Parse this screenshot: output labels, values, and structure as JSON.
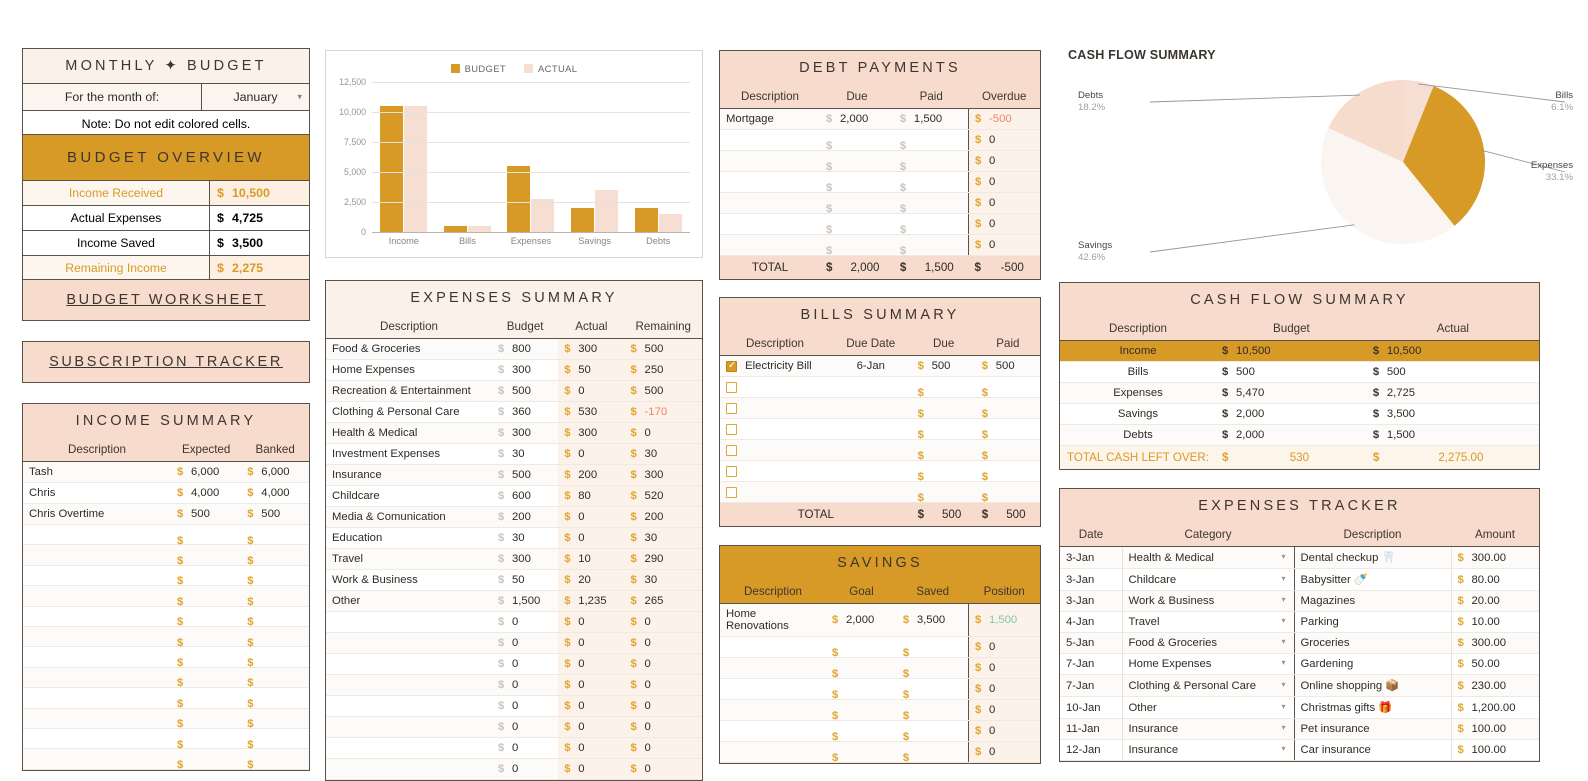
{
  "monthly_budget": {
    "title": "MONTHLY ✦ BUDGET",
    "month_label": "For the month of:",
    "month_value": "January",
    "note": "Note: Do not edit colored cells."
  },
  "budget_overview": {
    "title": "BUDGET OVERVIEW",
    "rows": [
      {
        "label": "Income Received",
        "amount": "10,500",
        "highlight": true
      },
      {
        "label": "Actual Expenses",
        "amount": "4,725",
        "highlight": false
      },
      {
        "label": "Income Saved",
        "amount": "3,500",
        "highlight": false
      },
      {
        "label": "Remaining Income",
        "amount": "2,275",
        "highlight": true
      }
    ]
  },
  "nav": {
    "budget_worksheet": "BUDGET WORKSHEET",
    "subscription_tracker": "SUBSCRIPTION TRACKER"
  },
  "income_summary": {
    "title": "INCOME SUMMARY",
    "columns": [
      "Description",
      "Expected",
      "Banked"
    ],
    "rows": [
      {
        "description": "Tash",
        "expected": "6,000",
        "banked": "6,000"
      },
      {
        "description": "Chris",
        "expected": "4,000",
        "banked": "4,000"
      },
      {
        "description": "Chris Overtime",
        "expected": "500",
        "banked": "500"
      },
      {
        "description": "",
        "expected": "",
        "banked": ""
      },
      {
        "description": "",
        "expected": "",
        "banked": ""
      },
      {
        "description": "",
        "expected": "",
        "banked": ""
      },
      {
        "description": "",
        "expected": "",
        "banked": ""
      },
      {
        "description": "",
        "expected": "",
        "banked": ""
      },
      {
        "description": "",
        "expected": "",
        "banked": ""
      },
      {
        "description": "",
        "expected": "",
        "banked": ""
      },
      {
        "description": "",
        "expected": "",
        "banked": ""
      },
      {
        "description": "",
        "expected": "",
        "banked": ""
      },
      {
        "description": "",
        "expected": "",
        "banked": ""
      },
      {
        "description": "",
        "expected": "",
        "banked": ""
      },
      {
        "description": "",
        "expected": "",
        "banked": ""
      }
    ]
  },
  "expenses_summary": {
    "title": "EXPENSES SUMMARY",
    "columns": [
      "Description",
      "Budget",
      "Actual",
      "Remaining"
    ],
    "rows": [
      {
        "description": "Food & Groceries",
        "budget": "800",
        "actual": "300",
        "remaining": "500"
      },
      {
        "description": "Home Expenses",
        "budget": "300",
        "actual": "50",
        "remaining": "250"
      },
      {
        "description": "Recreation & Entertainment",
        "budget": "500",
        "actual": "0",
        "remaining": "500"
      },
      {
        "description": "Clothing & Personal Care",
        "budget": "360",
        "actual": "530",
        "remaining": "-170",
        "negative": true
      },
      {
        "description": "Health & Medical",
        "budget": "300",
        "actual": "300",
        "remaining": "0"
      },
      {
        "description": "Investment Expenses",
        "budget": "30",
        "actual": "0",
        "remaining": "30"
      },
      {
        "description": "Insurance",
        "budget": "500",
        "actual": "200",
        "remaining": "300"
      },
      {
        "description": "Childcare",
        "budget": "600",
        "actual": "80",
        "remaining": "520"
      },
      {
        "description": "Media & Comunication",
        "budget": "200",
        "actual": "0",
        "remaining": "200"
      },
      {
        "description": "Education",
        "budget": "30",
        "actual": "0",
        "remaining": "30"
      },
      {
        "description": "Travel",
        "budget": "300",
        "actual": "10",
        "remaining": "290"
      },
      {
        "description": "Work & Business",
        "budget": "50",
        "actual": "20",
        "remaining": "30"
      },
      {
        "description": "Other",
        "budget": "1,500",
        "actual": "1,235",
        "remaining": "265"
      },
      {
        "description": "",
        "budget": "0",
        "actual": "0",
        "remaining": "0"
      },
      {
        "description": "",
        "budget": "0",
        "actual": "0",
        "remaining": "0"
      },
      {
        "description": "",
        "budget": "0",
        "actual": "0",
        "remaining": "0"
      },
      {
        "description": "",
        "budget": "0",
        "actual": "0",
        "remaining": "0"
      },
      {
        "description": "",
        "budget": "0",
        "actual": "0",
        "remaining": "0"
      },
      {
        "description": "",
        "budget": "0",
        "actual": "0",
        "remaining": "0"
      },
      {
        "description": "",
        "budget": "0",
        "actual": "0",
        "remaining": "0"
      },
      {
        "description": "",
        "budget": "0",
        "actual": "0",
        "remaining": "0"
      }
    ]
  },
  "debt_payments": {
    "title": "DEBT PAYMENTS",
    "columns": [
      "Description",
      "Due",
      "Paid",
      "Overdue"
    ],
    "rows": [
      {
        "description": "Mortgage",
        "due": "2,000",
        "paid": "1,500",
        "overdue": "-500",
        "negative": true
      },
      {
        "description": "",
        "due": "",
        "paid": "",
        "overdue": "0"
      },
      {
        "description": "",
        "due": "",
        "paid": "",
        "overdue": "0"
      },
      {
        "description": "",
        "due": "",
        "paid": "",
        "overdue": "0"
      },
      {
        "description": "",
        "due": "",
        "paid": "",
        "overdue": "0"
      },
      {
        "description": "",
        "due": "",
        "paid": "",
        "overdue": "0"
      },
      {
        "description": "",
        "due": "",
        "paid": "",
        "overdue": "0"
      }
    ],
    "total_label": "TOTAL",
    "total_due": "2,000",
    "total_paid": "1,500",
    "total_overdue": "-500"
  },
  "bills_summary": {
    "title": "BILLS SUMMARY",
    "columns": [
      "Description",
      "Due Date",
      "Due",
      "Paid"
    ],
    "rows": [
      {
        "checked": true,
        "description": "Electricity Bill",
        "due_date": "6-Jan",
        "due": "500",
        "paid": "500"
      },
      {
        "checked": false,
        "description": "",
        "due_date": "",
        "due": "",
        "paid": ""
      },
      {
        "checked": false,
        "description": "",
        "due_date": "",
        "due": "",
        "paid": ""
      },
      {
        "checked": false,
        "description": "",
        "due_date": "",
        "due": "",
        "paid": ""
      },
      {
        "checked": false,
        "description": "",
        "due_date": "",
        "due": "",
        "paid": ""
      },
      {
        "checked": false,
        "description": "",
        "due_date": "",
        "due": "",
        "paid": ""
      },
      {
        "checked": false,
        "description": "",
        "due_date": "",
        "due": "",
        "paid": ""
      }
    ],
    "total_label": "TOTAL",
    "total_due": "500",
    "total_paid": "500"
  },
  "savings": {
    "title": "SAVINGS",
    "columns": [
      "Description",
      "Goal",
      "Saved",
      "Position"
    ],
    "rows": [
      {
        "description": "Home Renovations",
        "goal": "2,000",
        "saved": "3,500",
        "position": "1,500",
        "positive": true
      },
      {
        "description": "",
        "goal": "",
        "saved": "",
        "position": "0"
      },
      {
        "description": "",
        "goal": "",
        "saved": "",
        "position": "0"
      },
      {
        "description": "",
        "goal": "",
        "saved": "",
        "position": "0"
      },
      {
        "description": "",
        "goal": "",
        "saved": "",
        "position": "0"
      },
      {
        "description": "",
        "goal": "",
        "saved": "",
        "position": "0"
      },
      {
        "description": "",
        "goal": "",
        "saved": "",
        "position": "0"
      }
    ]
  },
  "cash_flow_table": {
    "title": "CASH FLOW SUMMARY",
    "columns": [
      "Description",
      "Budget",
      "Actual"
    ],
    "rows": [
      {
        "description": "Income",
        "budget": "10,500",
        "actual": "10,500",
        "gold": true
      },
      {
        "description": "Bills",
        "budget": "500",
        "actual": "500",
        "gold": false
      },
      {
        "description": "Expenses",
        "budget": "5,470",
        "actual": "2,725",
        "gold": false
      },
      {
        "description": "Savings",
        "budget": "2,000",
        "actual": "3,500",
        "gold": false
      },
      {
        "description": "Debts",
        "budget": "2,000",
        "actual": "1,500",
        "gold": false
      }
    ],
    "total_label": "TOTAL CASH LEFT OVER:",
    "total_budget": "530",
    "total_actual": "2,275.00"
  },
  "expenses_tracker": {
    "title": "EXPENSES TRACKER",
    "columns": [
      "Date",
      "Category",
      "Description",
      "Amount"
    ],
    "rows": [
      {
        "date": "3-Jan",
        "category": "Health & Medical",
        "description": "Dental checkup 🦷",
        "amount": "300.00"
      },
      {
        "date": "3-Jan",
        "category": "Childcare",
        "description": "Babysitter 🍼",
        "amount": "80.00"
      },
      {
        "date": "3-Jan",
        "category": "Work & Business",
        "description": "Magazines",
        "amount": "20.00"
      },
      {
        "date": "4-Jan",
        "category": "Travel",
        "description": "Parking",
        "amount": "10.00"
      },
      {
        "date": "5-Jan",
        "category": "Food & Groceries",
        "description": "Groceries",
        "amount": "300.00"
      },
      {
        "date": "7-Jan",
        "category": "Home Expenses",
        "description": "Gardening",
        "amount": "50.00"
      },
      {
        "date": "7-Jan",
        "category": "Clothing & Personal Care",
        "description": "Online shopping 📦",
        "amount": "230.00"
      },
      {
        "date": "10-Jan",
        "category": "Other",
        "description": "Christmas gifts 🎁",
        "amount": "1,200.00"
      },
      {
        "date": "11-Jan",
        "category": "Insurance",
        "description": "Pet insurance",
        "amount": "100.00"
      },
      {
        "date": "12-Jan",
        "category": "Insurance",
        "description": "Car insurance",
        "amount": "100.00"
      }
    ]
  },
  "colors": {
    "gold": "#D89A26",
    "pink": "#F7DBCC",
    "cream": "#FBF1E8",
    "actual_light": "#F6DFD2",
    "border": "#5A5248"
  },
  "chart_data": [
    {
      "type": "bar",
      "title": "",
      "categories": [
        "Income",
        "Bills",
        "Expenses",
        "Savings",
        "Debts"
      ],
      "series": [
        {
          "name": "BUDGET",
          "values": [
            10500,
            500,
            5470,
            2000,
            2000
          ],
          "color": "#D89A26"
        },
        {
          "name": "ACTUAL",
          "values": [
            10500,
            500,
            2725,
            3500,
            1500
          ],
          "color": "#F6DFD2"
        }
      ],
      "ylim": [
        0,
        12500
      ],
      "yticks": [
        0,
        2500,
        5000,
        7500,
        10000,
        12500
      ],
      "ytick_labels": [
        "0",
        "2,500",
        "5,000",
        "7,500",
        "10,000",
        "12,500"
      ],
      "xlabel": "",
      "ylabel": "",
      "grid": true,
      "legend_position": "top"
    },
    {
      "type": "pie",
      "title": "CASH FLOW SUMMARY",
      "labels": [
        "Bills",
        "Expenses",
        "Savings",
        "Debts"
      ],
      "values": [
        6.1,
        33.1,
        42.6,
        18.2
      ],
      "value_labels": [
        "6.1%",
        "33.1%",
        "42.6%",
        "18.2%"
      ],
      "colors": [
        "#F6DFD2",
        "#D89A26",
        "#FAF5F1",
        "#F6DCCC"
      ],
      "legend_position": "callout"
    }
  ]
}
